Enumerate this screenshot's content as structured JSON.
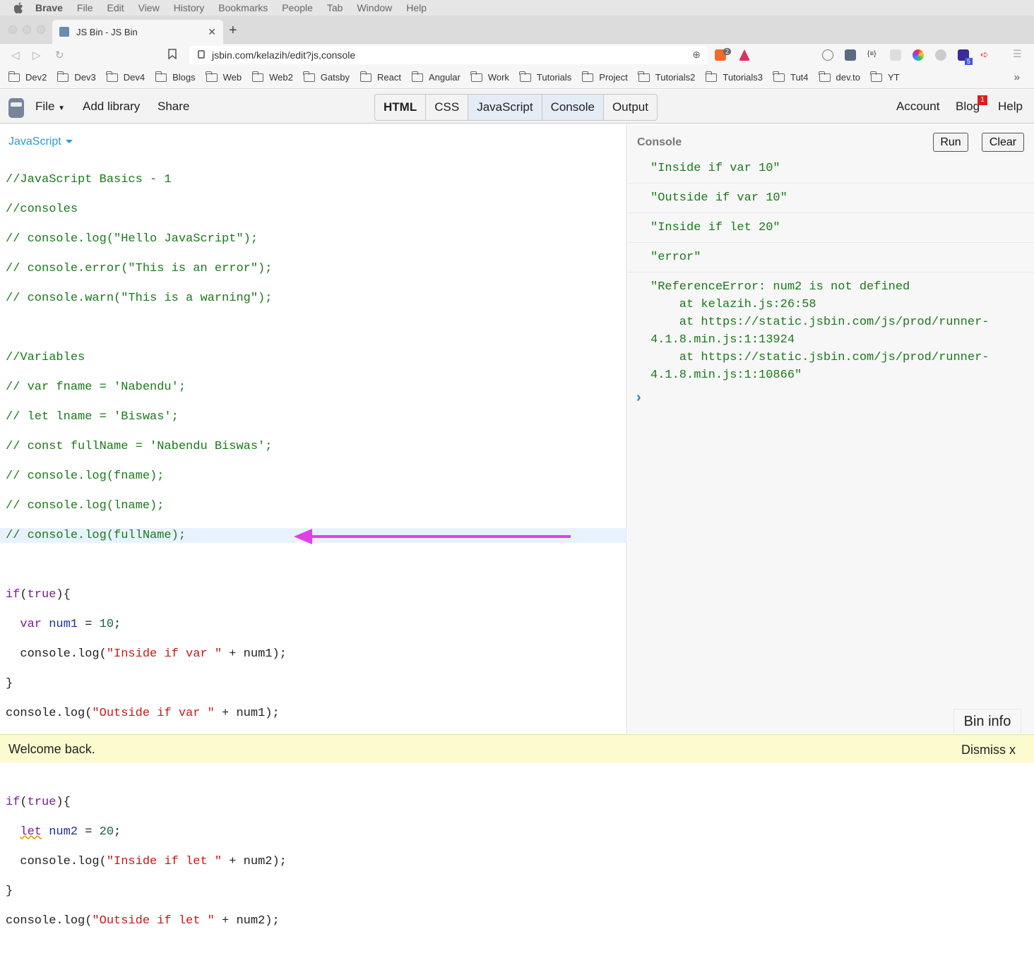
{
  "menubar": {
    "app": "Brave",
    "items": [
      "File",
      "Edit",
      "View",
      "History",
      "Bookmarks",
      "People",
      "Tab",
      "Window",
      "Help"
    ]
  },
  "browser": {
    "tab_title": "JS Bin - JS Bin",
    "url": "jsbin.com/kelazih/edit?js,console",
    "bookmarks": [
      "Dev2",
      "Dev3",
      "Dev4",
      "Blogs",
      "Web",
      "Web2",
      "Gatsby",
      "React",
      "Angular",
      "Work",
      "Tutorials",
      "Project",
      "Tutorials2",
      "Tutorials3",
      "Tut4",
      "dev.to",
      "YT"
    ],
    "brave_badge": "2",
    "ext_badge": "5"
  },
  "jsbin": {
    "file": "File",
    "add_library": "Add library",
    "share": "Share",
    "panels": [
      "HTML",
      "CSS",
      "JavaScript",
      "Console",
      "Output"
    ],
    "account": "Account",
    "blog": "Blog",
    "blog_badge": "1",
    "help": "Help"
  },
  "editor": {
    "language": "JavaScript"
  },
  "console": {
    "title": "Console",
    "run": "Run",
    "clear": "Clear",
    "outputs": [
      "\"Inside if var 10\"",
      "\"Outside if var 10\"",
      "\"Inside if let 20\"",
      "\"error\"",
      "\"ReferenceError: num2 is not defined\n    at kelazih.js:26:58\n    at https://static.jsbin.com/js/prod/runner-\n4.1.8.min.js:1:13924\n    at https://static.jsbin.com/js/prod/runner-\n4.1.8.min.js:1:10866\""
    ],
    "prompt": "›",
    "bin_info": "Bin info"
  },
  "welcome": {
    "message": "Welcome back.",
    "dismiss": "Dismiss x"
  },
  "colors": {
    "accent": "#2b9bd4",
    "arrow": "#e040e8"
  }
}
